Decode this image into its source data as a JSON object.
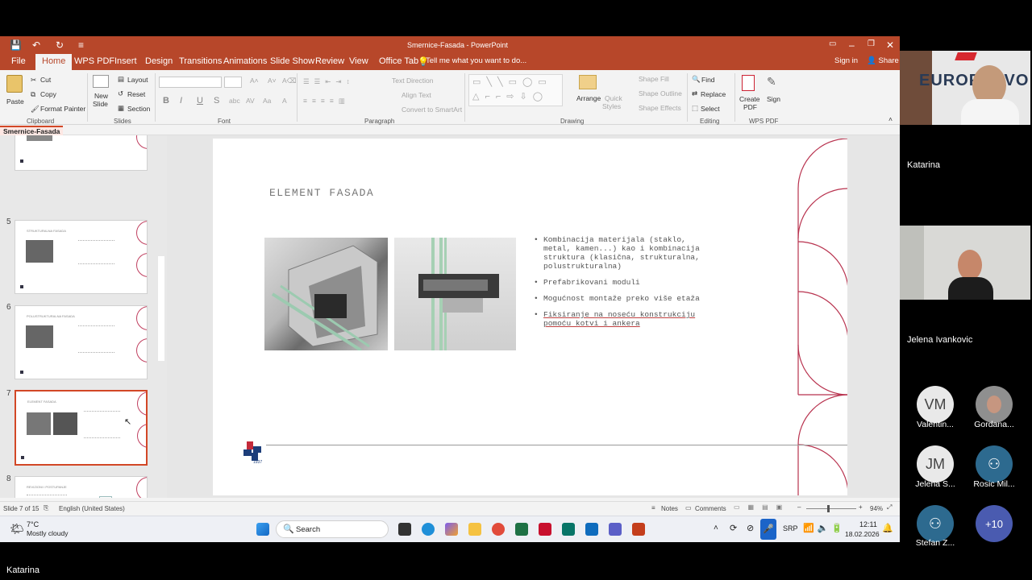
{
  "window": {
    "title": "Smernice-Fasada - PowerPoint"
  },
  "qat": {
    "save": "💾",
    "undo": "↶",
    "redo": "↻"
  },
  "tabs": [
    "File",
    "Home",
    "WPS PDF",
    "Insert",
    "Design",
    "Transitions",
    "Animations",
    "Slide Show",
    "Review",
    "View",
    "Office Tab"
  ],
  "tellme": "Tell me what you want to do...",
  "signin": "Sign in",
  "share": "Share",
  "ribbon": {
    "paste": "Paste",
    "cut": "Cut",
    "copy": "Copy",
    "format_painter": "Format Painter",
    "clipboard": "Clipboard",
    "new_slide": "New",
    "new_slide2": "Slide",
    "layout": "Layout",
    "reset": "Reset",
    "section": "Section",
    "slides": "Slides",
    "font": "Font",
    "paragraph": "Paragraph",
    "text_direction": "Text Direction",
    "align_text": "Align Text",
    "convert_smartart": "Convert to SmartArt",
    "arrange": "Arrange",
    "quick_styles": "Quick",
    "quick_styles2": "Styles",
    "shape_fill": "Shape Fill",
    "shape_outline": "Shape Outline",
    "shape_effects": "Shape Effects",
    "drawing": "Drawing",
    "find": "Find",
    "replace": "Replace",
    "select": "Select",
    "editing": "Editing",
    "create_pdf": "Create",
    "create_pdf2": "PDF",
    "sign": "Sign",
    "wps_pdf": "WPS PDF"
  },
  "doc_tab": "Smernice-Fasada",
  "thumbnails": [
    {
      "num": "5",
      "title": "STRUKTURALNA FASADA"
    },
    {
      "num": "6",
      "title": "POLUSTRUKTURALNA FASADA"
    },
    {
      "num": "7",
      "title": "ELEMENT FASADA"
    },
    {
      "num": "8",
      "title": "REVIZIONI I POSTUPANJE"
    }
  ],
  "slide": {
    "title": "ELEMENT FASADA",
    "bullets": [
      "Kombinacija materijala (staklo, metal, kamen...) kao i kombinacija struktura (klasična, strukturalna, polustrukturalna)",
      "Prefabrikovani moduli",
      "Mogućnost montaže preko više etaža",
      "Fiksiranje na noseću konstrukciju pomoću kotvi i ankera"
    ],
    "logo_year": "1937"
  },
  "status": {
    "slide": "Slide 7 of 15",
    "language": "English (United States)",
    "notes": "Notes",
    "comments": "Comments",
    "zoom": "94%"
  },
  "taskbar": {
    "temp": "7°C",
    "weather": "Mostly cloudy",
    "search": "Search",
    "lang": "SRP",
    "time": "12:11",
    "date": "18.02.2026"
  },
  "participants": {
    "presenter": "Katarina",
    "video1_name": "Katarina",
    "video1_brand": "EUROPRAVO",
    "video2_name": "Jelena Ivankovic",
    "people": [
      {
        "initials": "VM",
        "name": "Valentin...",
        "color": "#e9e9e9"
      },
      {
        "initials": "",
        "name": "Gordana...",
        "color": "#888"
      },
      {
        "initials": "JM",
        "name": "Jelena S...",
        "color": "#e9e9e9"
      },
      {
        "initials": "",
        "name": "Rosic Mil...",
        "color": "#2d6a8f"
      },
      {
        "initials": "",
        "name": "Stefan Z...",
        "color": "#2d6a8f"
      },
      {
        "initials": "+10",
        "name": "",
        "color": "#4a5bb0"
      }
    ]
  }
}
